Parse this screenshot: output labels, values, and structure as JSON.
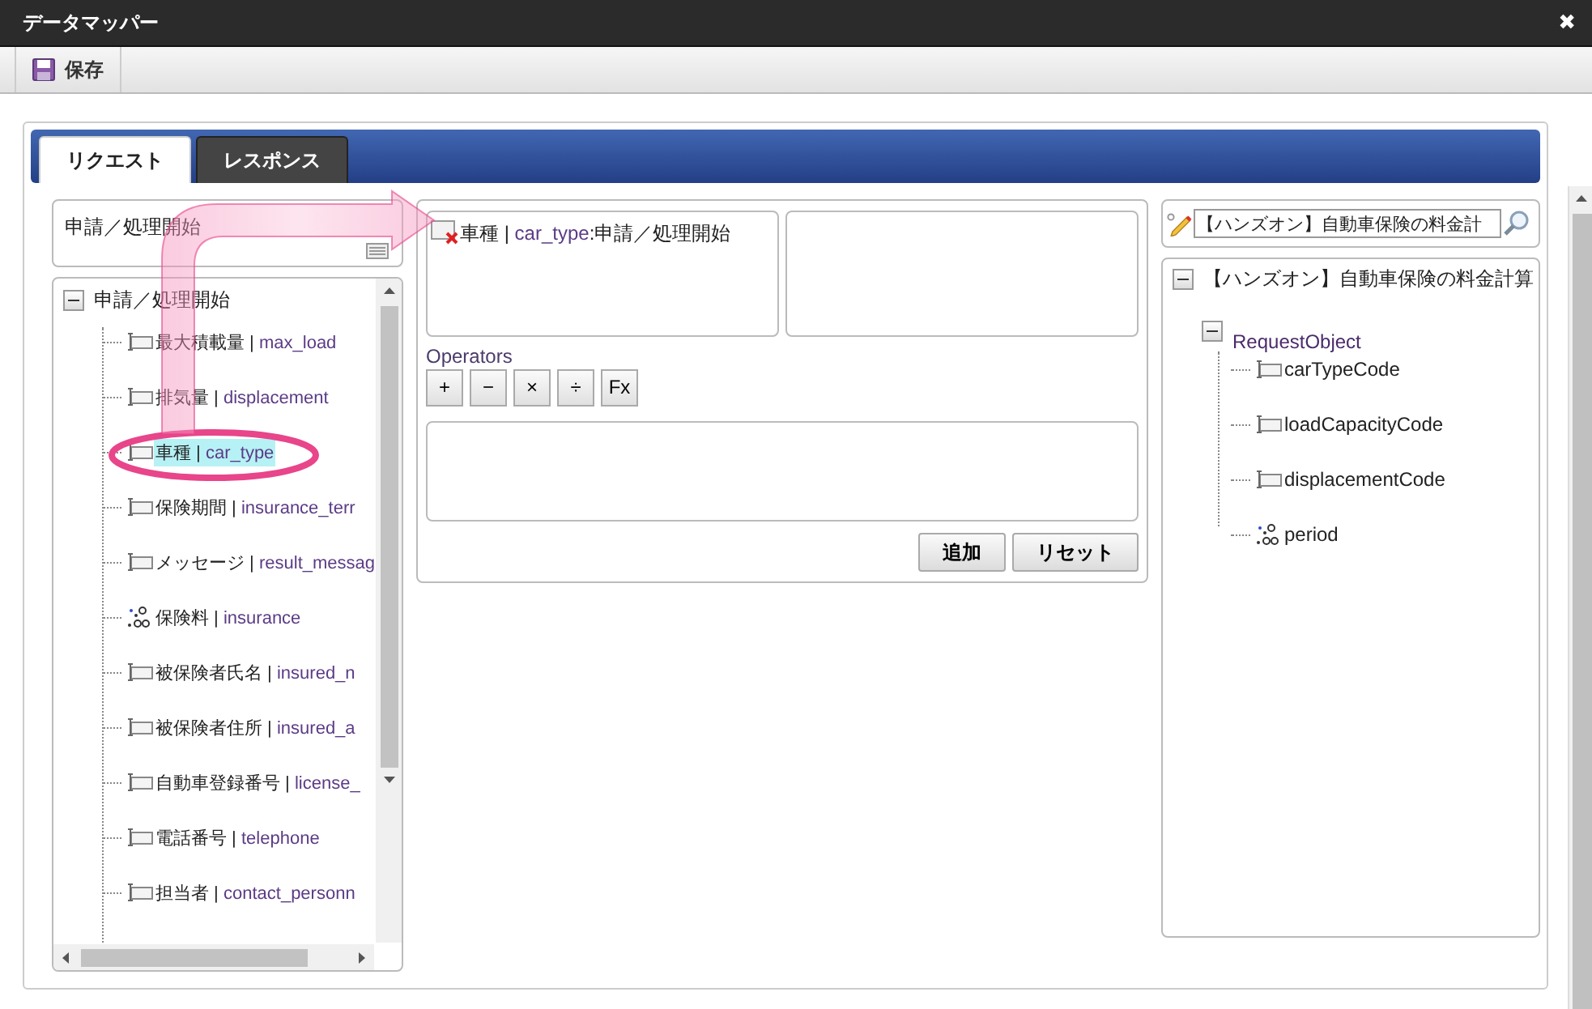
{
  "window": {
    "title": "データマッパー",
    "close": "✖"
  },
  "toolbar": {
    "save": "保存"
  },
  "tabs": [
    {
      "label": "リクエスト",
      "selected": true
    },
    {
      "label": "レスポンス",
      "selected": false
    }
  ],
  "source": {
    "selector": "申請／処理開始",
    "tree": {
      "label": "申請／処理開始",
      "expanded": true,
      "children": [
        {
          "kind": "field",
          "label": "最大積載量",
          "name": "max_load",
          "selected": false
        },
        {
          "kind": "field",
          "label": "排気量",
          "name": "displacement",
          "selected": false
        },
        {
          "kind": "field",
          "label": "車種",
          "name": "car_type",
          "selected": true
        },
        {
          "kind": "field",
          "label": "保険期間",
          "name": "insurance_terr",
          "selected": false
        },
        {
          "kind": "field",
          "label": "メッセージ",
          "name": "result_messag",
          "selected": false
        },
        {
          "kind": "number",
          "label": "保険料",
          "name": "insurance",
          "selected": false
        },
        {
          "kind": "field",
          "label": "被保険者氏名",
          "name": "insured_n",
          "selected": false
        },
        {
          "kind": "field",
          "label": "被保険者住所",
          "name": "insured_a",
          "selected": false
        },
        {
          "kind": "field",
          "label": "自動車登録番号",
          "name": "license_",
          "selected": false
        },
        {
          "kind": "field",
          "label": "電話番号",
          "name": "telephone",
          "selected": false
        },
        {
          "kind": "field",
          "label": "担当者",
          "name": "contact_personn",
          "selected": false
        }
      ]
    }
  },
  "separator": "|",
  "mapping": {
    "source_item": {
      "label": "車種",
      "separator": "|",
      "name": "car_type",
      "colon": ":",
      "parent": "申請／処理開始"
    },
    "operators_label": "Operators",
    "operators": [
      "+",
      "−",
      "×",
      "÷",
      "Fx"
    ],
    "buttons": [
      "追加",
      "リセット"
    ]
  },
  "target": {
    "search": "【ハンズオン】自動車保険の料金計",
    "tree": {
      "label": "【ハンズオン】自動車保険の料金計算",
      "expanded": true,
      "children": [
        {
          "label": "RequestObject",
          "expanded": true,
          "children": [
            {
              "kind": "field",
              "label": "carTypeCode"
            },
            {
              "kind": "field",
              "label": "loadCapacityCode"
            },
            {
              "kind": "field",
              "label": "displacementCode"
            },
            {
              "kind": "number",
              "label": "period"
            }
          ]
        }
      ]
    }
  }
}
